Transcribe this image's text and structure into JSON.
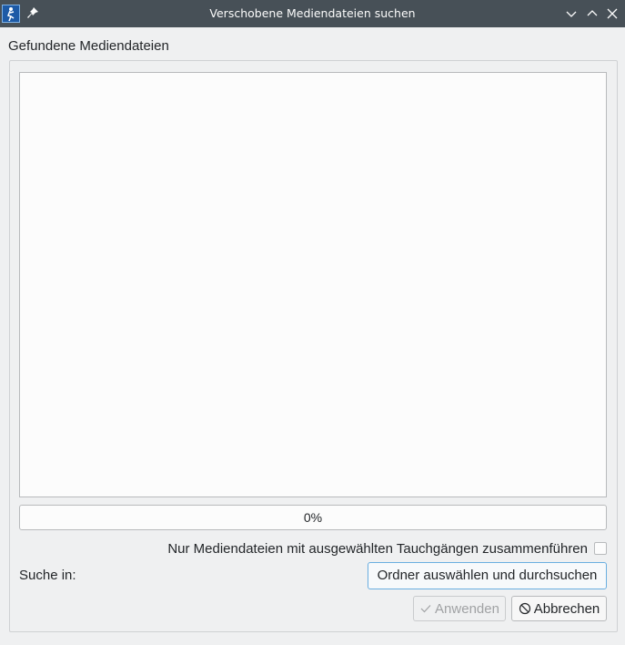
{
  "window": {
    "title": "Verschobene Mediendateien suchen"
  },
  "group": {
    "title": "Gefundene Mediendateien"
  },
  "progress": {
    "value": 0,
    "label": "0%"
  },
  "options": {
    "only_selected_dives_label": "Nur Mediendateien mit ausgewählten Tauchgängen zusammenführen",
    "only_selected_dives_checked": false
  },
  "search": {
    "label": "Suche in:",
    "scan_button_label": "Ordner auswählen und durchsuchen"
  },
  "buttons": {
    "apply_label": "Anwenden",
    "apply_enabled": false,
    "cancel_label": "Abbrechen"
  },
  "icons": {
    "app": "subsurface-diver-icon",
    "pin": "pin-icon",
    "minimize": "chevron-down-icon",
    "maximize": "chevron-up-icon",
    "close": "close-icon",
    "apply": "checkmark-icon",
    "cancel": "cancel-circle-icon"
  },
  "colors": {
    "titlebar": "#475057",
    "window_bg": "#eff0f1",
    "focus_border": "#6aaee0"
  }
}
